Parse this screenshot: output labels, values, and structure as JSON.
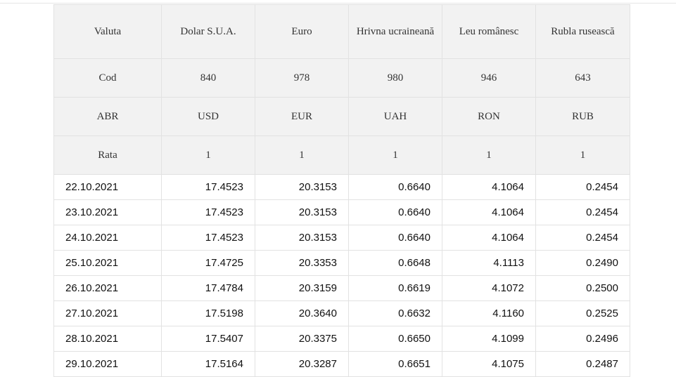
{
  "table": {
    "header_rows": [
      {
        "label": "Valuta",
        "cells": [
          "Dolar S.U.A.",
          "Euro",
          "Hrivna ucraineană",
          "Leu românesc",
          "Rubla rusească"
        ]
      },
      {
        "label": "Cod",
        "cells": [
          "840",
          "978",
          "980",
          "946",
          "643"
        ]
      },
      {
        "label": "ABR",
        "cells": [
          "USD",
          "EUR",
          "UAH",
          "RON",
          "RUB"
        ]
      },
      {
        "label": "Rata",
        "cells": [
          "1",
          "1",
          "1",
          "1",
          "1"
        ]
      }
    ],
    "rows": [
      {
        "date": "22.10.2021",
        "values": [
          "17.4523",
          "20.3153",
          "0.6640",
          "4.1064",
          "0.2454"
        ]
      },
      {
        "date": "23.10.2021",
        "values": [
          "17.4523",
          "20.3153",
          "0.6640",
          "4.1064",
          "0.2454"
        ]
      },
      {
        "date": "24.10.2021",
        "values": [
          "17.4523",
          "20.3153",
          "0.6640",
          "4.1064",
          "0.2454"
        ]
      },
      {
        "date": "25.10.2021",
        "values": [
          "17.4725",
          "20.3353",
          "0.6648",
          "4.1113",
          "0.2490"
        ]
      },
      {
        "date": "26.10.2021",
        "values": [
          "17.4784",
          "20.3159",
          "0.6619",
          "4.1072",
          "0.2500"
        ]
      },
      {
        "date": "27.10.2021",
        "values": [
          "17.5198",
          "20.3640",
          "0.6632",
          "4.1160",
          "0.2525"
        ]
      },
      {
        "date": "28.10.2021",
        "values": [
          "17.5407",
          "20.3375",
          "0.6650",
          "4.1099",
          "0.2496"
        ]
      },
      {
        "date": "29.10.2021",
        "values": [
          "17.5164",
          "20.3287",
          "0.6651",
          "4.1075",
          "0.2487"
        ]
      }
    ]
  },
  "colors": {
    "header_background": "#f2f2f2",
    "border": "#e2e2e2",
    "text": "#111111"
  }
}
